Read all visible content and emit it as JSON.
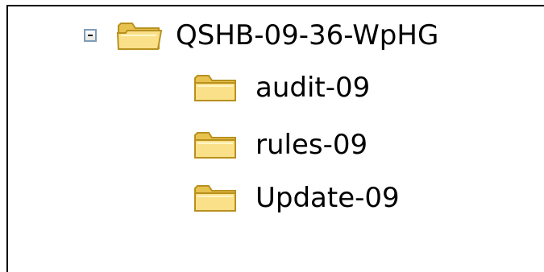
{
  "tree": {
    "root": {
      "label": "QSHB-09-36-WpHG",
      "expanded": true,
      "expander_icon": "minus-box-icon",
      "folder_icon": "open-folder-icon",
      "children": [
        {
          "label": "audit-09",
          "folder_icon": "folder-icon"
        },
        {
          "label": "rules-09",
          "folder_icon": "folder-icon"
        },
        {
          "label": "Update-09",
          "folder_icon": "folder-icon"
        }
      ]
    }
  },
  "colors": {
    "folder_fill": "#F5D76E",
    "folder_outline": "#C9A227",
    "expander_border": "#7F9DB9",
    "background": "#FFFFFF"
  }
}
